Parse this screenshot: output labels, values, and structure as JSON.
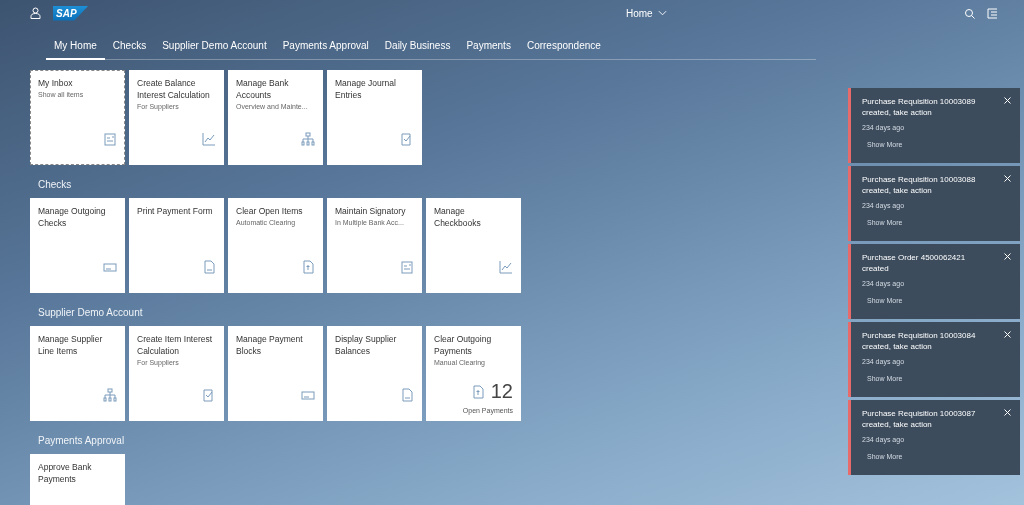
{
  "header": {
    "logo": "SAP",
    "title": "Home"
  },
  "tabs": [
    {
      "label": "My Home",
      "selected": true
    },
    {
      "label": "Checks",
      "selected": false
    },
    {
      "label": "Supplier Demo Account",
      "selected": false
    },
    {
      "label": "Payments Approval",
      "selected": false
    },
    {
      "label": "Daily Business",
      "selected": false
    },
    {
      "label": "Payments",
      "selected": false
    },
    {
      "label": "Correspondence",
      "selected": false
    }
  ],
  "groups": [
    {
      "tiles": [
        {
          "kind": "app",
          "title": "My Inbox",
          "subtitle": "Show all items",
          "focused": true
        },
        {
          "kind": "app",
          "title": "Create Balance Interest Calculation",
          "subtitle": "For Suppliers",
          "focused": false
        },
        {
          "kind": "app",
          "title": "Manage Bank Accounts",
          "subtitle": "Overview and Mainte...",
          "focused": false
        },
        {
          "kind": "app",
          "title": "Manage Journal Entries",
          "focused": false
        }
      ]
    },
    {
      "title": "Checks",
      "tiles": [
        {
          "kind": "app",
          "title": "Manage Outgoing Checks",
          "focused": false
        },
        {
          "kind": "app",
          "title": "Print Payment Form",
          "focused": false
        },
        {
          "kind": "app",
          "title": "Clear Open Items",
          "subtitle": "Automatic Clearing",
          "focused": false
        },
        {
          "kind": "app",
          "title": "Maintain Signatory",
          "subtitle": "In Multiple Bank Acc...",
          "focused": false
        },
        {
          "kind": "app",
          "title": "Manage Checkbooks",
          "focused": false
        }
      ]
    },
    {
      "title": "Supplier Demo Account",
      "tiles": [
        {
          "kind": "app",
          "title": "Manage Supplier Line Items",
          "focused": false
        },
        {
          "kind": "app",
          "title": "Create Item Interest Calculation",
          "subtitle": "For Suppliers",
          "focused": false
        },
        {
          "kind": "app",
          "title": "Manage Payment Blocks",
          "focused": false
        },
        {
          "kind": "app",
          "title": "Display Supplier Balances",
          "focused": false
        },
        {
          "kind": "kpi",
          "title": "Clear Outgoing Payments",
          "subtitle": "Manual Clearing",
          "number": "12",
          "footer": "Open Payments",
          "focused": false
        }
      ]
    },
    {
      "title": "Payments Approval",
      "tiles": [
        {
          "kind": "app",
          "title": "Approve Bank Payments",
          "focused": false
        }
      ]
    }
  ],
  "notifications": [
    {
      "title": "Purchase Requisition 10003089 created, take action",
      "time": "234 days ago",
      "action": "Show More",
      "color": "#e86b6b"
    },
    {
      "title": "Purchase Requisition 10003088 created, take action",
      "time": "234 days ago",
      "action": "Show More",
      "color": "#e86b6b"
    },
    {
      "title": "Purchase Order 4500062421 created",
      "time": "234 days ago",
      "action": "Show More",
      "color": "#e86b6b"
    },
    {
      "title": "Purchase Requisition 10003084 created, take action",
      "time": "234 days ago",
      "action": "Show More",
      "color": "#e86b6b"
    },
    {
      "title": "Purchase Requisition 10003087 created, take action",
      "time": "234 days ago",
      "action": "Show More",
      "color": "#e86b6b"
    }
  ]
}
